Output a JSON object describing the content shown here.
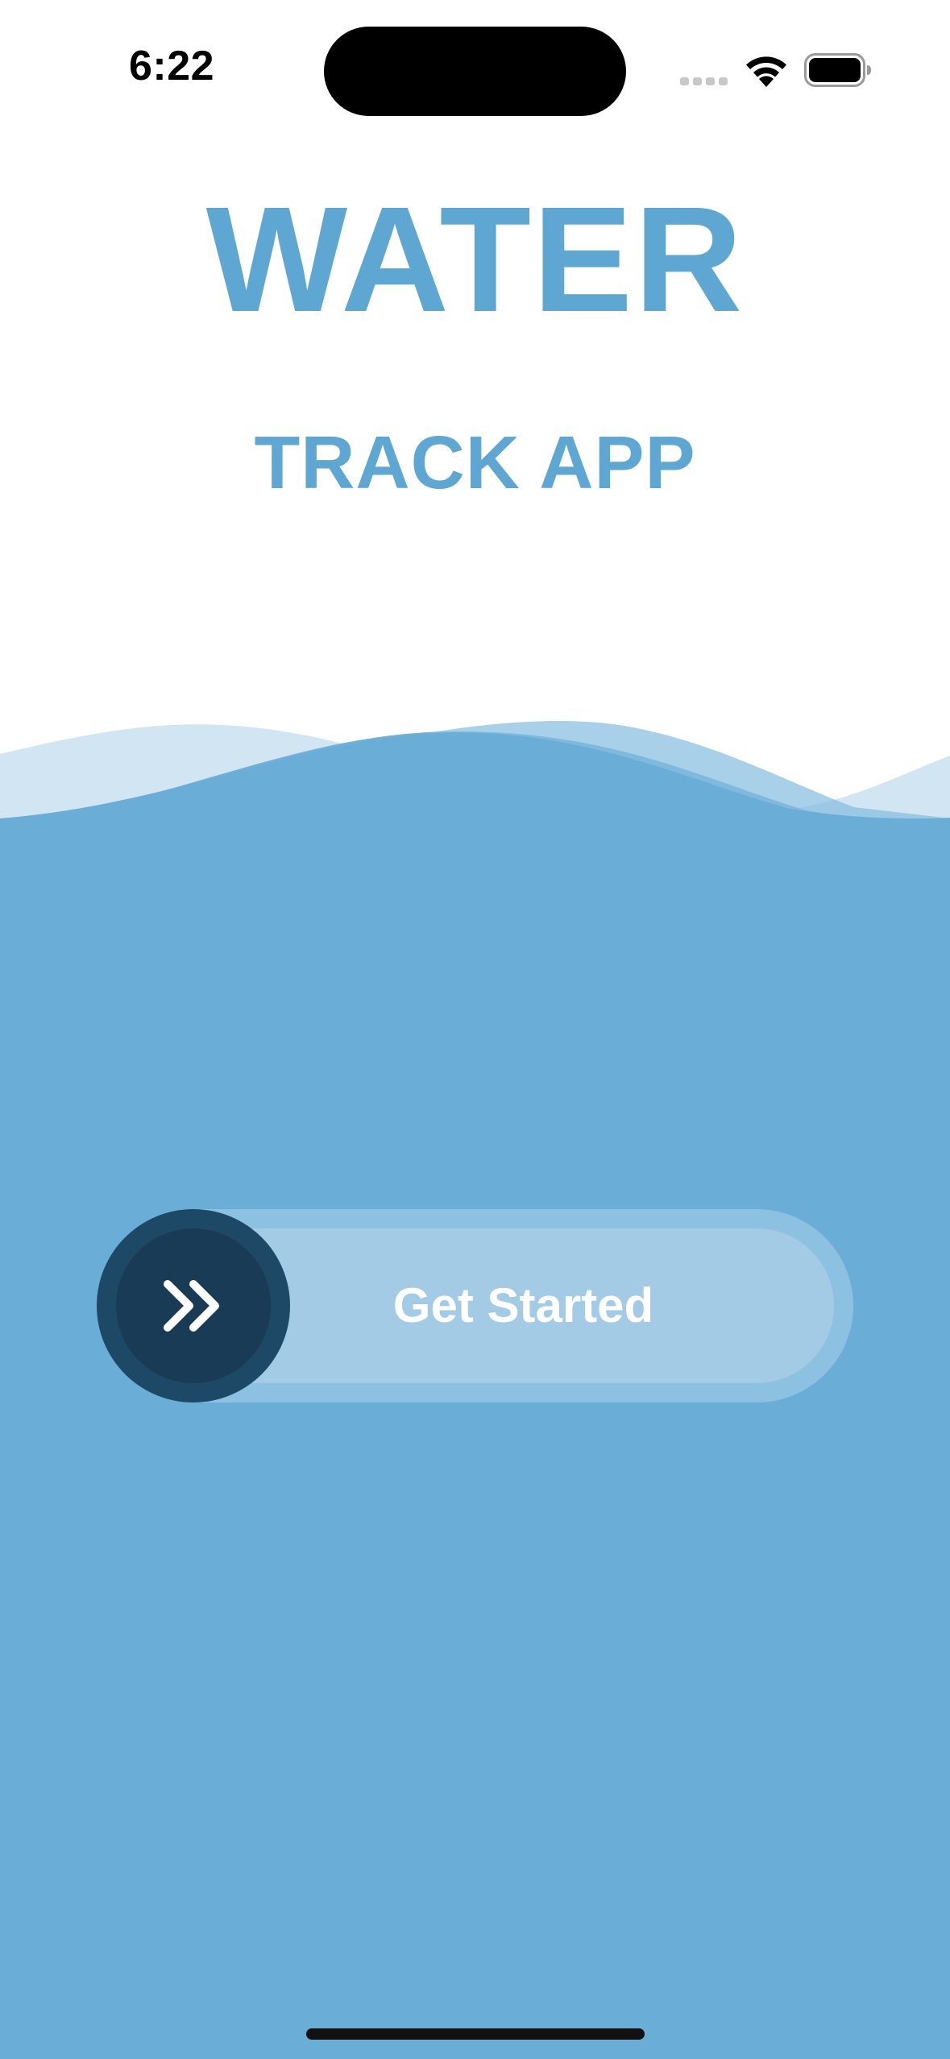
{
  "status_bar": {
    "time": "6:22",
    "signal_icon": "cellular-signal-icon",
    "wifi_icon": "wifi-icon",
    "battery_icon": "battery-icon"
  },
  "title": {
    "main": "WATER",
    "sub": "TRACK APP"
  },
  "slider": {
    "label": "Get Started",
    "knob_icon": "double-chevron-right-icon"
  },
  "colors": {
    "title": "#5ea7d3",
    "water": "#6aadd7",
    "knob": "#1d4866",
    "track": "#a3cbe5"
  }
}
